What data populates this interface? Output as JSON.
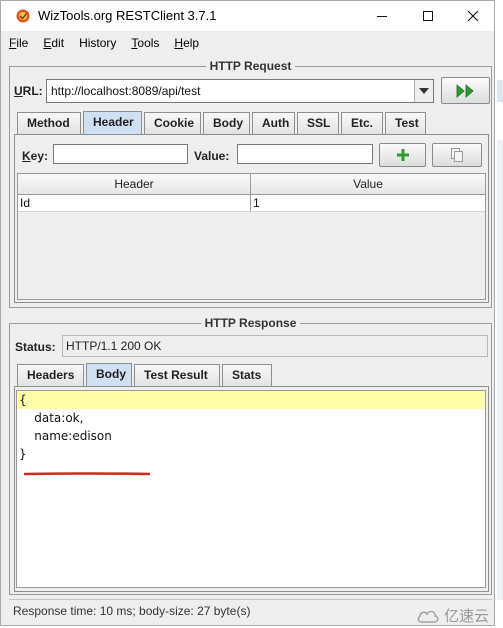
{
  "window": {
    "title": "WizTools.org RESTClient 3.7.1",
    "icons": {
      "app": "wiztools-logo-icon",
      "minimize": "minimize-icon",
      "maximize": "maximize-icon",
      "close": "close-icon"
    }
  },
  "menu": [
    {
      "mnemonic": "F",
      "rest": "ile"
    },
    {
      "mnemonic": "E",
      "rest": "dit"
    },
    {
      "mnemonic": "",
      "rest": "History"
    },
    {
      "mnemonic": "T",
      "rest": "ools"
    },
    {
      "mnemonic": "H",
      "rest": "elp"
    }
  ],
  "request": {
    "title": "HTTP Request",
    "url_label_u": "U",
    "url_label_rest": "RL:",
    "url_value": "http://localhost:8089/api/test",
    "tabs": [
      "Method",
      "Header",
      "Cookie",
      "Body",
      "Auth",
      "SSL",
      "Etc.",
      "Test"
    ],
    "active_tab": "Header",
    "key_label_u": "K",
    "key_label_rest": "ey:",
    "value_label": "Value:",
    "key_value": "",
    "value_value": "",
    "table": {
      "columns": [
        "Header",
        "Value"
      ],
      "rows": [
        {
          "header": "Id",
          "value": "1"
        }
      ]
    }
  },
  "response": {
    "title": "HTTP Response",
    "status_label": "Status:",
    "status_value": "HTTP/1.1 200 OK",
    "tabs": [
      "Headers",
      "Body",
      "Test Result",
      "Stats"
    ],
    "active_tab": "Body",
    "body_lines": [
      "{",
      "    data:ok,",
      "    name:edison",
      "}"
    ]
  },
  "statusbar": {
    "text": "Response time: 10 ms; body-size: 27 byte(s)"
  },
  "watermark": {
    "text": "亿速云"
  },
  "colors": {
    "accent": "#cfe0f2",
    "highlight": "#ffffaa",
    "annotation_line": "#d32a1e",
    "go_green": "#2e9b2e"
  }
}
